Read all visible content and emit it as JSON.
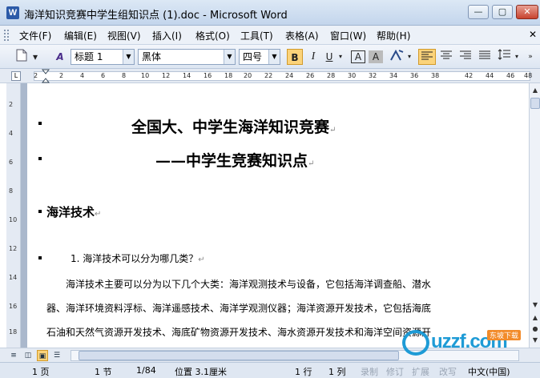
{
  "window": {
    "title": "海洋知识竞赛中学生组知识点 (1).doc - Microsoft Word",
    "app_icon": "W",
    "controls": [
      "—",
      "▢",
      "✕"
    ]
  },
  "menu": {
    "items": [
      "文件(F)",
      "编辑(E)",
      "视图(V)",
      "插入(I)",
      "格式(O)",
      "工具(T)",
      "表格(A)",
      "窗口(W)",
      "帮助(H)"
    ],
    "close_glyph": "✕"
  },
  "toolbar": {
    "new_icon": "new-document-icon",
    "style_icon_text": "A",
    "style_value": "标题 1",
    "font_value": "黑体",
    "size_value": "四号",
    "bold": "B",
    "italic": "I",
    "underline": "U",
    "char_border": "A",
    "char_shading": "A",
    "highlight": "A",
    "accent": "#fbd37a"
  },
  "ruler": {
    "numbers": [
      "2",
      "2",
      "4",
      "6",
      "8",
      "10",
      "12",
      "14",
      "16",
      "18",
      "20",
      "22",
      "24",
      "26",
      "28",
      "30",
      "32",
      "34",
      "36",
      "38",
      "42",
      "44",
      "46",
      "48"
    ]
  },
  "vruler": {
    "numbers": [
      "2",
      "4",
      "6",
      "8",
      "10",
      "12",
      "14",
      "16",
      "18"
    ]
  },
  "document": {
    "title_line1": "全国大、中学生海洋知识竞赛",
    "title_line2": "——中学生竞赛知识点",
    "section_heading": "海洋技术",
    "question": "1. 海洋技术可以分为哪几类？",
    "para_line1": "海洋技术主要可以分为以下几个大类：海洋观测技术与设备，它包括海洋调查船、潜水",
    "para_line2": "器、海洋环境资料浮标、海洋遥感技术、海洋学观测仪器；海洋资源开发技术，它包括海底",
    "para_line3": "石油和天然气资源开发技术、海底矿物资源开发技术、海水资源开发技术和海洋空间资源开",
    "paragraph_mark": "↵"
  },
  "status": {
    "page": "1 页",
    "section": "1 节",
    "pages": "1/84",
    "position": "位置 3.1厘米",
    "line": "1 行",
    "column": "1 列",
    "record": "录制",
    "revision": "修订",
    "extend": "扩展",
    "overtype": "改写",
    "language": "中文(中国)"
  },
  "watermark": {
    "brand": "uzzf.com",
    "tag": "东坡下载"
  }
}
